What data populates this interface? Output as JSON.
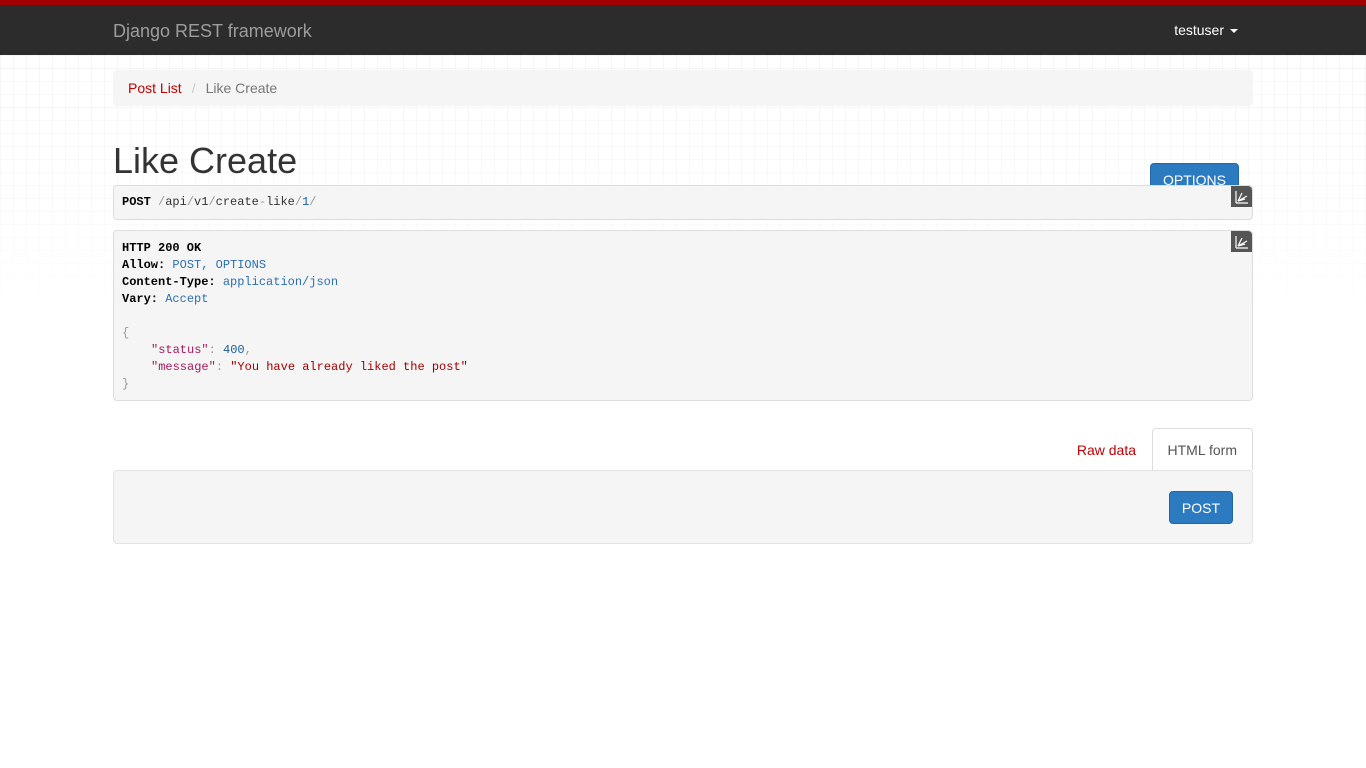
{
  "navbar": {
    "brand": "Django REST framework",
    "user": "testuser",
    "accent_color": "#a30000"
  },
  "breadcrumb": {
    "items": [
      {
        "label": "Post List",
        "active": false
      },
      {
        "label": "Like Create",
        "active": true
      }
    ],
    "separator": "/"
  },
  "page": {
    "title": "Like Create",
    "options_label": "OPTIONS"
  },
  "request": {
    "method": "POST",
    "path_parts": [
      "/",
      "api",
      "/",
      "v1",
      "/",
      "create",
      "-",
      "like",
      "/",
      "1",
      "/"
    ]
  },
  "response": {
    "status_line": "HTTP 200 OK",
    "headers": [
      {
        "name": "Allow:",
        "value": "POST, OPTIONS"
      },
      {
        "name": "Content-Type:",
        "value": "application/json"
      },
      {
        "name": "Vary:",
        "value": "Accept"
      }
    ],
    "body": {
      "open": "{",
      "close": "}",
      "fields": [
        {
          "key": "\"status\"",
          "value": "400",
          "trailing": ","
        },
        {
          "key": "\"message\"",
          "value": "\"You have already liked the post\"",
          "trailing": ""
        }
      ]
    }
  },
  "tabs": {
    "raw_label": "Raw data",
    "html_label": "HTML form",
    "active": "HTML form"
  },
  "form": {
    "submit_label": "POST"
  },
  "icons": {
    "prettyprint": "prettyprint-icon",
    "caret": "caret-down-icon"
  },
  "colors": {
    "link": "#c20000",
    "button": "#2c7bc0",
    "navbar_bg": "#2c2c2c"
  }
}
